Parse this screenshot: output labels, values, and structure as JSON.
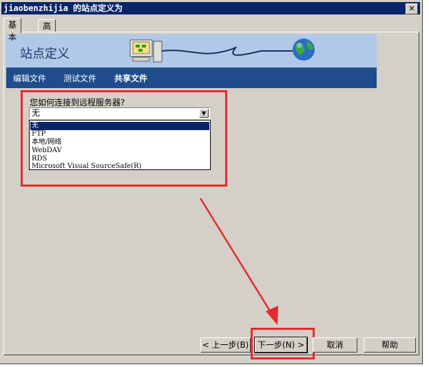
{
  "window": {
    "title": "jiaobenzhijia 的站点定义为",
    "close_glyph": "✕"
  },
  "tabs": [
    {
      "label": "基本"
    },
    {
      "label": "高级"
    }
  ],
  "header": {
    "title": "站点定义"
  },
  "nav": {
    "items": [
      {
        "label": "编辑文件"
      },
      {
        "label": "测试文件"
      },
      {
        "label": "共享文件"
      }
    ]
  },
  "form": {
    "question": "您如何连接到远程服务器?",
    "selected": "无",
    "options": [
      "无",
      "FTP",
      "本地/网络",
      "WebDAV",
      "RDS",
      "Microsoft Visual SourceSafe(R)"
    ],
    "highlighted_index": 0
  },
  "buttons": {
    "back": "< 上一步(B)",
    "next": "下一步(N) >",
    "cancel": "取消",
    "help": "帮助"
  },
  "colors": {
    "annotation": "#e8282c",
    "titlebar": "#0a246a",
    "header_band": "#b2c8e8",
    "nav_band": "#1f4c8c"
  }
}
